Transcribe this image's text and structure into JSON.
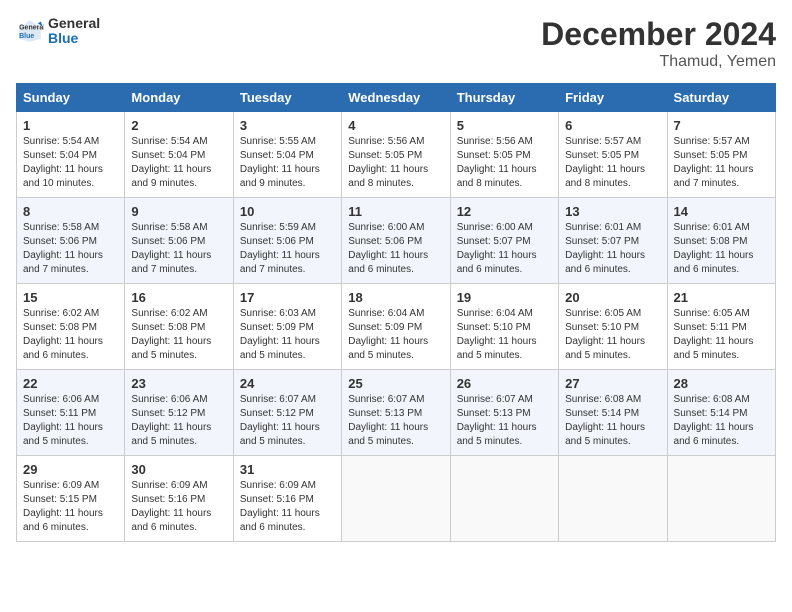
{
  "header": {
    "logo_general": "General",
    "logo_blue": "Blue",
    "month": "December 2024",
    "location": "Thamud, Yemen"
  },
  "days_of_week": [
    "Sunday",
    "Monday",
    "Tuesday",
    "Wednesday",
    "Thursday",
    "Friday",
    "Saturday"
  ],
  "weeks": [
    [
      {
        "day": 1,
        "sunrise": "5:54 AM",
        "sunset": "5:04 PM",
        "daylight": "11 hours and 10 minutes"
      },
      {
        "day": 2,
        "sunrise": "5:54 AM",
        "sunset": "5:04 PM",
        "daylight": "11 hours and 9 minutes"
      },
      {
        "day": 3,
        "sunrise": "5:55 AM",
        "sunset": "5:04 PM",
        "daylight": "11 hours and 9 minutes"
      },
      {
        "day": 4,
        "sunrise": "5:56 AM",
        "sunset": "5:05 PM",
        "daylight": "11 hours and 8 minutes"
      },
      {
        "day": 5,
        "sunrise": "5:56 AM",
        "sunset": "5:05 PM",
        "daylight": "11 hours and 8 minutes"
      },
      {
        "day": 6,
        "sunrise": "5:57 AM",
        "sunset": "5:05 PM",
        "daylight": "11 hours and 8 minutes"
      },
      {
        "day": 7,
        "sunrise": "5:57 AM",
        "sunset": "5:05 PM",
        "daylight": "11 hours and 7 minutes"
      }
    ],
    [
      {
        "day": 8,
        "sunrise": "5:58 AM",
        "sunset": "5:06 PM",
        "daylight": "11 hours and 7 minutes"
      },
      {
        "day": 9,
        "sunrise": "5:58 AM",
        "sunset": "5:06 PM",
        "daylight": "11 hours and 7 minutes"
      },
      {
        "day": 10,
        "sunrise": "5:59 AM",
        "sunset": "5:06 PM",
        "daylight": "11 hours and 7 minutes"
      },
      {
        "day": 11,
        "sunrise": "6:00 AM",
        "sunset": "5:06 PM",
        "daylight": "11 hours and 6 minutes"
      },
      {
        "day": 12,
        "sunrise": "6:00 AM",
        "sunset": "5:07 PM",
        "daylight": "11 hours and 6 minutes"
      },
      {
        "day": 13,
        "sunrise": "6:01 AM",
        "sunset": "5:07 PM",
        "daylight": "11 hours and 6 minutes"
      },
      {
        "day": 14,
        "sunrise": "6:01 AM",
        "sunset": "5:08 PM",
        "daylight": "11 hours and 6 minutes"
      }
    ],
    [
      {
        "day": 15,
        "sunrise": "6:02 AM",
        "sunset": "5:08 PM",
        "daylight": "11 hours and 6 minutes"
      },
      {
        "day": 16,
        "sunrise": "6:02 AM",
        "sunset": "5:08 PM",
        "daylight": "11 hours and 5 minutes"
      },
      {
        "day": 17,
        "sunrise": "6:03 AM",
        "sunset": "5:09 PM",
        "daylight": "11 hours and 5 minutes"
      },
      {
        "day": 18,
        "sunrise": "6:04 AM",
        "sunset": "5:09 PM",
        "daylight": "11 hours and 5 minutes"
      },
      {
        "day": 19,
        "sunrise": "6:04 AM",
        "sunset": "5:10 PM",
        "daylight": "11 hours and 5 minutes"
      },
      {
        "day": 20,
        "sunrise": "6:05 AM",
        "sunset": "5:10 PM",
        "daylight": "11 hours and 5 minutes"
      },
      {
        "day": 21,
        "sunrise": "6:05 AM",
        "sunset": "5:11 PM",
        "daylight": "11 hours and 5 minutes"
      }
    ],
    [
      {
        "day": 22,
        "sunrise": "6:06 AM",
        "sunset": "5:11 PM",
        "daylight": "11 hours and 5 minutes"
      },
      {
        "day": 23,
        "sunrise": "6:06 AM",
        "sunset": "5:12 PM",
        "daylight": "11 hours and 5 minutes"
      },
      {
        "day": 24,
        "sunrise": "6:07 AM",
        "sunset": "5:12 PM",
        "daylight": "11 hours and 5 minutes"
      },
      {
        "day": 25,
        "sunrise": "6:07 AM",
        "sunset": "5:13 PM",
        "daylight": "11 hours and 5 minutes"
      },
      {
        "day": 26,
        "sunrise": "6:07 AM",
        "sunset": "5:13 PM",
        "daylight": "11 hours and 5 minutes"
      },
      {
        "day": 27,
        "sunrise": "6:08 AM",
        "sunset": "5:14 PM",
        "daylight": "11 hours and 5 minutes"
      },
      {
        "day": 28,
        "sunrise": "6:08 AM",
        "sunset": "5:14 PM",
        "daylight": "11 hours and 6 minutes"
      }
    ],
    [
      {
        "day": 29,
        "sunrise": "6:09 AM",
        "sunset": "5:15 PM",
        "daylight": "11 hours and 6 minutes"
      },
      {
        "day": 30,
        "sunrise": "6:09 AM",
        "sunset": "5:16 PM",
        "daylight": "11 hours and 6 minutes"
      },
      {
        "day": 31,
        "sunrise": "6:09 AM",
        "sunset": "5:16 PM",
        "daylight": "11 hours and 6 minutes"
      },
      null,
      null,
      null,
      null
    ]
  ]
}
